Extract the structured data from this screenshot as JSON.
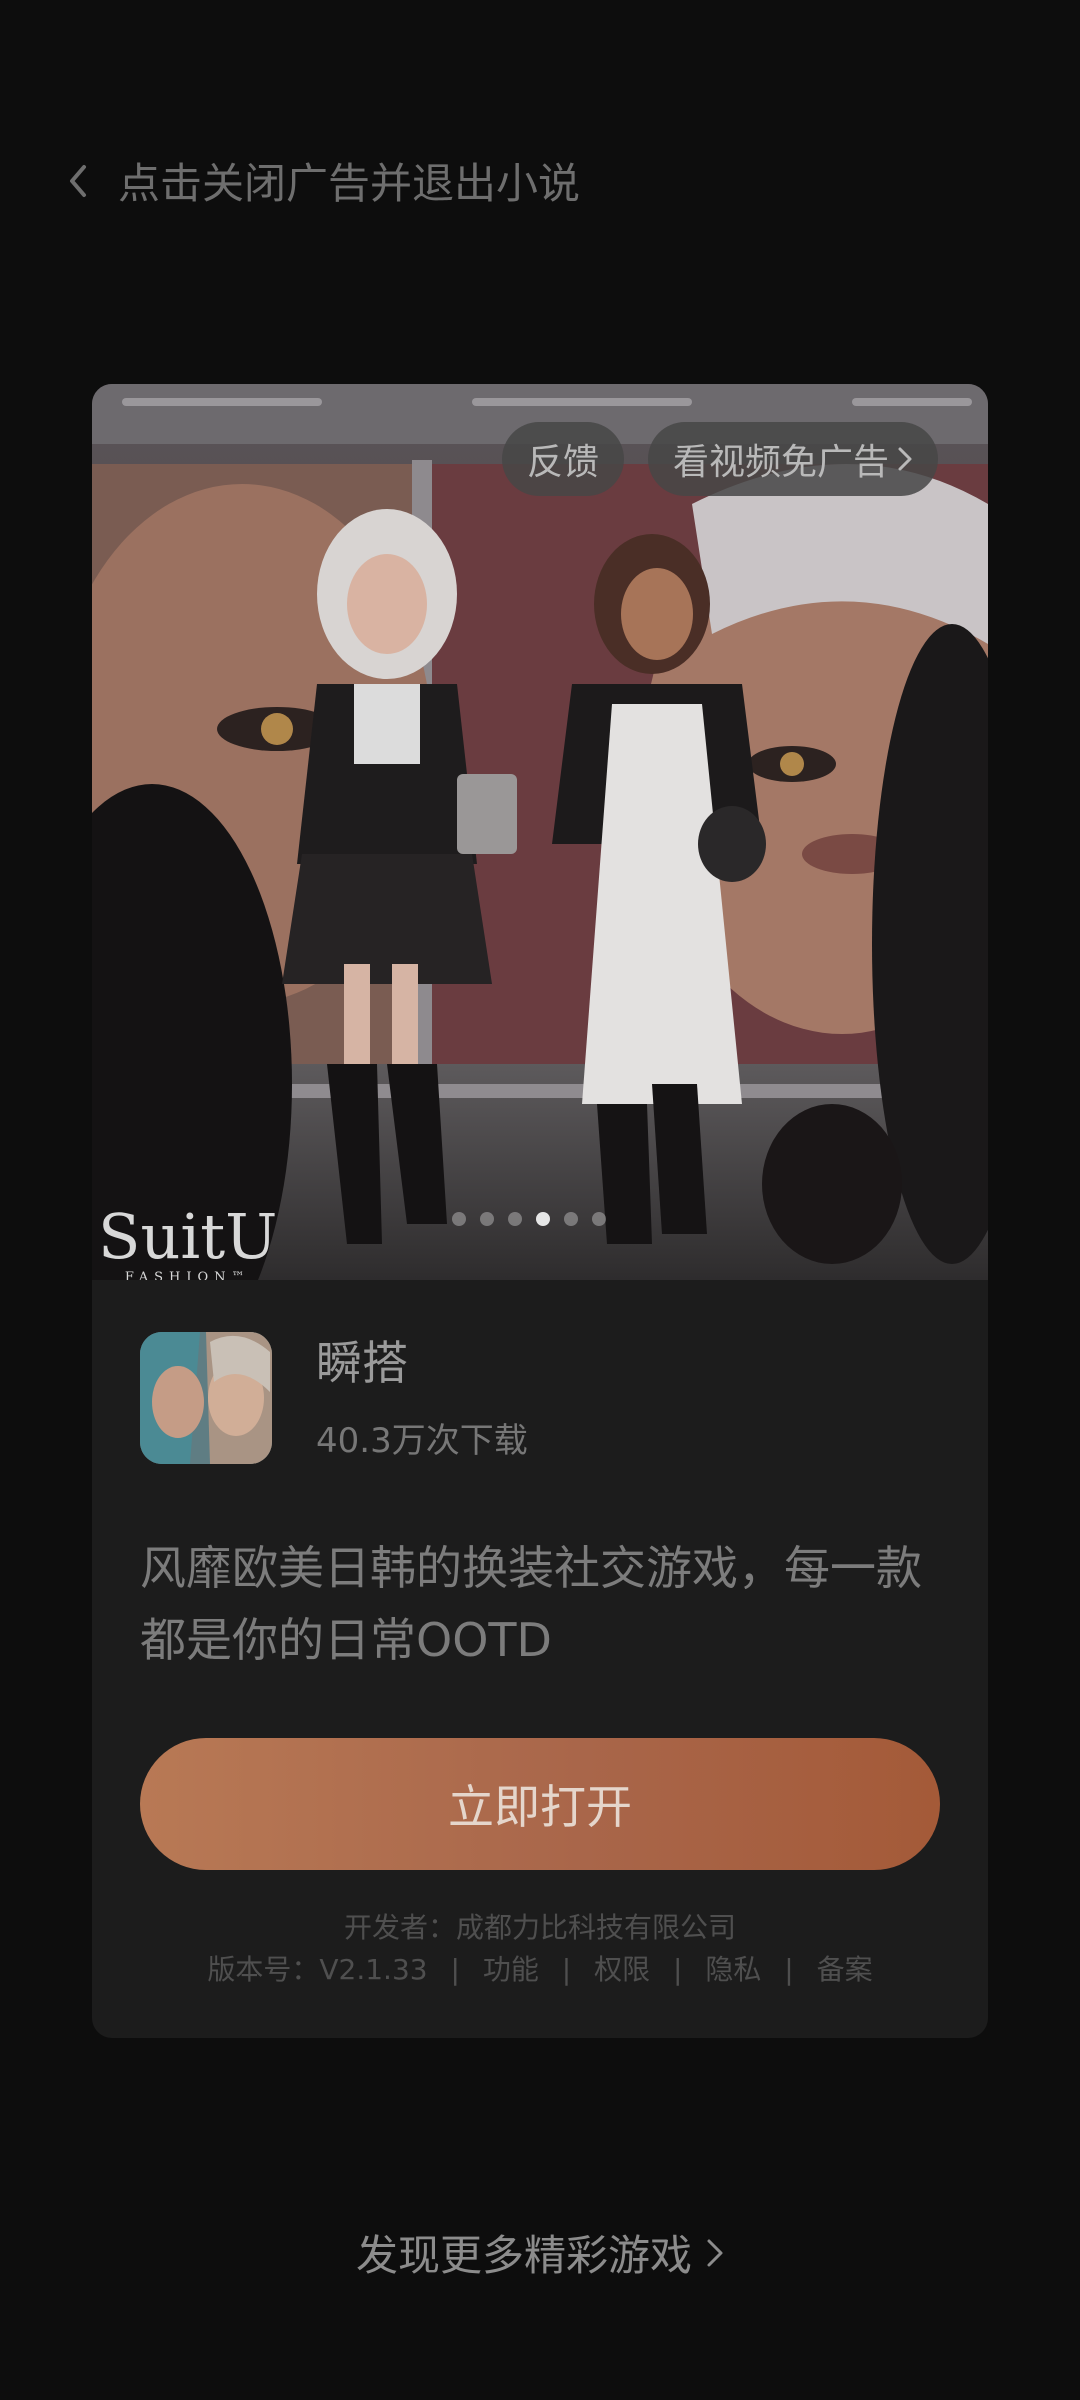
{
  "top_bar": {
    "close_text": "点击关闭广告并退出小说"
  },
  "banner": {
    "feedback_label": "反馈",
    "skip_ad_label": "看视频免广告",
    "brand_name": "SuitU",
    "brand_sub": "FASHION™",
    "carousel": {
      "total": 6,
      "active_index": 3
    }
  },
  "app": {
    "name": "瞬搭",
    "downloads": "40.3万次下载",
    "description": "风靡欧美日韩的换装社交游戏，每一款都是你的日常OOTD",
    "open_button": "立即打开",
    "developer": "开发者：成都力比科技有限公司",
    "version": "版本号：V2.1.33",
    "links": [
      "功能",
      "权限",
      "隐私",
      "备案"
    ]
  },
  "footer": {
    "more_games": "发现更多精彩游戏"
  },
  "colors": {
    "background": "#0d0d0d",
    "card": "#1c1c1c",
    "button_start": "#b87955",
    "button_end": "#a45a38"
  }
}
